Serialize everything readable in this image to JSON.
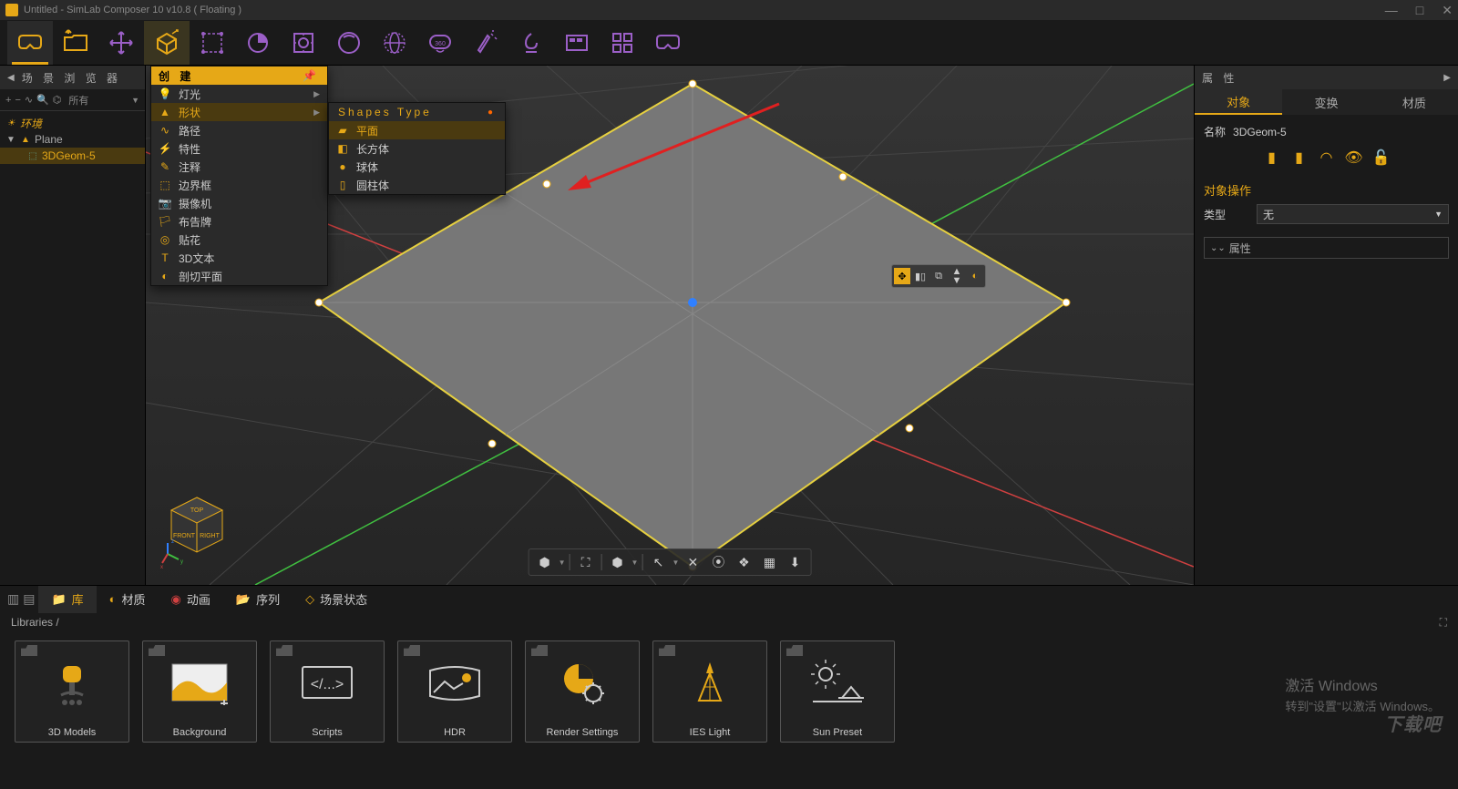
{
  "title": "Untitled - SimLab Composer 10 v10.8 ( Floating )",
  "scene_browser": {
    "title": "场 景 浏 览 器",
    "filter": "所有",
    "items": {
      "env": "环境",
      "plane": "Plane",
      "geom": "3DGeom-5"
    }
  },
  "create_menu": {
    "header": "创 建",
    "items": [
      "灯光",
      "形状",
      "路径",
      "特性",
      "注释",
      "边界框",
      "摄像机",
      "布告牌",
      "贴花",
      "3D文本",
      "剖切平面"
    ]
  },
  "shapes_menu": {
    "header": "Shapes Type",
    "items": [
      "平面",
      "长方体",
      "球体",
      "圆柱体"
    ]
  },
  "properties": {
    "title": "属 性",
    "tabs": [
      "对象",
      "变换",
      "材质"
    ],
    "name_label": "名称",
    "name_value": "3DGeom-5",
    "ops_title": "对象操作",
    "type_label": "类型",
    "type_value": "无",
    "expand": "属性"
  },
  "bottom_tabs": [
    "库",
    "材质",
    "动画",
    "序列",
    "场景状态"
  ],
  "breadcrumb": "Libraries  /",
  "library": [
    "3D Models",
    "Background",
    "Scripts",
    "HDR",
    "Render Settings",
    "IES Light",
    "Sun Preset"
  ],
  "watermark": {
    "l1": "激活 Windows",
    "l2": "转到\"设置\"以激活 Windows。"
  },
  "brand": "下载吧"
}
